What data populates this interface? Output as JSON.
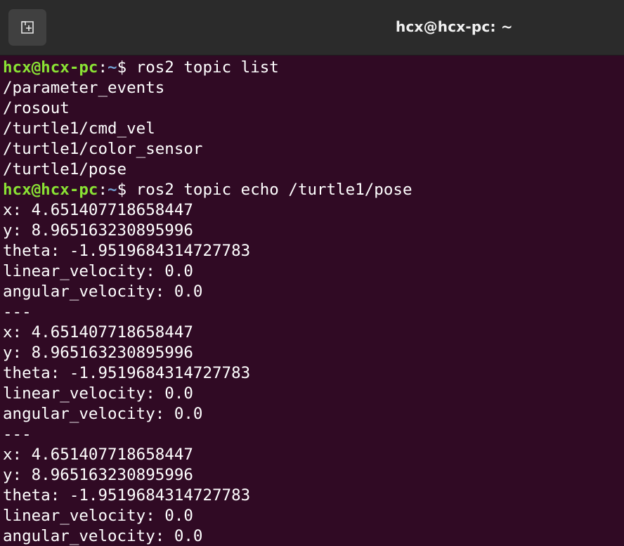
{
  "window": {
    "title": "hcx@hcx-pc: ~",
    "new_tab_icon": "new-tab-icon"
  },
  "colors": {
    "background": "#300a24",
    "prompt_user": "#8ae234",
    "prompt_path": "#729fcf",
    "text": "#ffffff",
    "titlebar": "#2b2b2b"
  },
  "prompt": {
    "user_host": "hcx@hcx-pc",
    "separator": ":",
    "path": "~",
    "symbol": "$ "
  },
  "session": {
    "cmd1": "ros2 topic list",
    "topics": [
      "/parameter_events",
      "/rosout",
      "/turtle1/cmd_vel",
      "/turtle1/color_sensor",
      "/turtle1/pose"
    ],
    "cmd2": "ros2 topic echo /turtle1/pose",
    "messages": [
      {
        "x": "x: 4.651407718658447",
        "y": "y: 8.965163230895996",
        "theta": "theta: -1.9519684314727783",
        "linear_velocity": "linear_velocity: 0.0",
        "angular_velocity": "angular_velocity: 0.0",
        "separator": "---"
      },
      {
        "x": "x: 4.651407718658447",
        "y": "y: 8.965163230895996",
        "theta": "theta: -1.9519684314727783",
        "linear_velocity": "linear_velocity: 0.0",
        "angular_velocity": "angular_velocity: 0.0",
        "separator": "---"
      },
      {
        "x": "x: 4.651407718658447",
        "y": "y: 8.965163230895996",
        "theta": "theta: -1.9519684314727783",
        "linear_velocity": "linear_velocity: 0.0",
        "angular_velocity": "angular_velocity: 0.0"
      }
    ]
  }
}
